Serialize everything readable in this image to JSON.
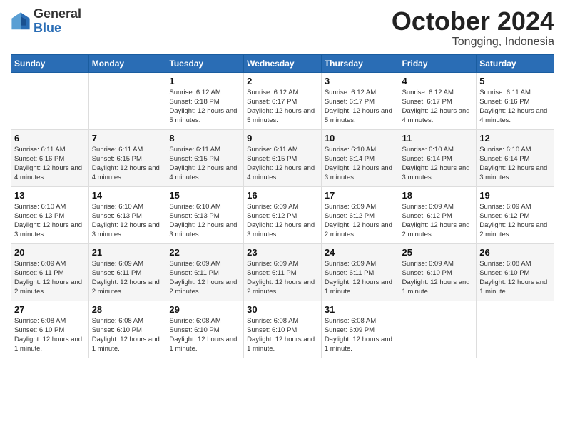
{
  "header": {
    "logo_general": "General",
    "logo_blue": "Blue",
    "month_year": "October 2024",
    "location": "Tongging, Indonesia"
  },
  "days_of_week": [
    "Sunday",
    "Monday",
    "Tuesday",
    "Wednesday",
    "Thursday",
    "Friday",
    "Saturday"
  ],
  "weeks": [
    [
      {
        "day": "",
        "info": ""
      },
      {
        "day": "",
        "info": ""
      },
      {
        "day": "1",
        "info": "Sunrise: 6:12 AM\nSunset: 6:18 PM\nDaylight: 12 hours and 5 minutes."
      },
      {
        "day": "2",
        "info": "Sunrise: 6:12 AM\nSunset: 6:17 PM\nDaylight: 12 hours and 5 minutes."
      },
      {
        "day": "3",
        "info": "Sunrise: 6:12 AM\nSunset: 6:17 PM\nDaylight: 12 hours and 5 minutes."
      },
      {
        "day": "4",
        "info": "Sunrise: 6:12 AM\nSunset: 6:17 PM\nDaylight: 12 hours and 4 minutes."
      },
      {
        "day": "5",
        "info": "Sunrise: 6:11 AM\nSunset: 6:16 PM\nDaylight: 12 hours and 4 minutes."
      }
    ],
    [
      {
        "day": "6",
        "info": "Sunrise: 6:11 AM\nSunset: 6:16 PM\nDaylight: 12 hours and 4 minutes."
      },
      {
        "day": "7",
        "info": "Sunrise: 6:11 AM\nSunset: 6:15 PM\nDaylight: 12 hours and 4 minutes."
      },
      {
        "day": "8",
        "info": "Sunrise: 6:11 AM\nSunset: 6:15 PM\nDaylight: 12 hours and 4 minutes."
      },
      {
        "day": "9",
        "info": "Sunrise: 6:11 AM\nSunset: 6:15 PM\nDaylight: 12 hours and 4 minutes."
      },
      {
        "day": "10",
        "info": "Sunrise: 6:10 AM\nSunset: 6:14 PM\nDaylight: 12 hours and 3 minutes."
      },
      {
        "day": "11",
        "info": "Sunrise: 6:10 AM\nSunset: 6:14 PM\nDaylight: 12 hours and 3 minutes."
      },
      {
        "day": "12",
        "info": "Sunrise: 6:10 AM\nSunset: 6:14 PM\nDaylight: 12 hours and 3 minutes."
      }
    ],
    [
      {
        "day": "13",
        "info": "Sunrise: 6:10 AM\nSunset: 6:13 PM\nDaylight: 12 hours and 3 minutes."
      },
      {
        "day": "14",
        "info": "Sunrise: 6:10 AM\nSunset: 6:13 PM\nDaylight: 12 hours and 3 minutes."
      },
      {
        "day": "15",
        "info": "Sunrise: 6:10 AM\nSunset: 6:13 PM\nDaylight: 12 hours and 3 minutes."
      },
      {
        "day": "16",
        "info": "Sunrise: 6:09 AM\nSunset: 6:12 PM\nDaylight: 12 hours and 3 minutes."
      },
      {
        "day": "17",
        "info": "Sunrise: 6:09 AM\nSunset: 6:12 PM\nDaylight: 12 hours and 2 minutes."
      },
      {
        "day": "18",
        "info": "Sunrise: 6:09 AM\nSunset: 6:12 PM\nDaylight: 12 hours and 2 minutes."
      },
      {
        "day": "19",
        "info": "Sunrise: 6:09 AM\nSunset: 6:12 PM\nDaylight: 12 hours and 2 minutes."
      }
    ],
    [
      {
        "day": "20",
        "info": "Sunrise: 6:09 AM\nSunset: 6:11 PM\nDaylight: 12 hours and 2 minutes."
      },
      {
        "day": "21",
        "info": "Sunrise: 6:09 AM\nSunset: 6:11 PM\nDaylight: 12 hours and 2 minutes."
      },
      {
        "day": "22",
        "info": "Sunrise: 6:09 AM\nSunset: 6:11 PM\nDaylight: 12 hours and 2 minutes."
      },
      {
        "day": "23",
        "info": "Sunrise: 6:09 AM\nSunset: 6:11 PM\nDaylight: 12 hours and 2 minutes."
      },
      {
        "day": "24",
        "info": "Sunrise: 6:09 AM\nSunset: 6:11 PM\nDaylight: 12 hours and 1 minute."
      },
      {
        "day": "25",
        "info": "Sunrise: 6:09 AM\nSunset: 6:10 PM\nDaylight: 12 hours and 1 minute."
      },
      {
        "day": "26",
        "info": "Sunrise: 6:08 AM\nSunset: 6:10 PM\nDaylight: 12 hours and 1 minute."
      }
    ],
    [
      {
        "day": "27",
        "info": "Sunrise: 6:08 AM\nSunset: 6:10 PM\nDaylight: 12 hours and 1 minute."
      },
      {
        "day": "28",
        "info": "Sunrise: 6:08 AM\nSunset: 6:10 PM\nDaylight: 12 hours and 1 minute."
      },
      {
        "day": "29",
        "info": "Sunrise: 6:08 AM\nSunset: 6:10 PM\nDaylight: 12 hours and 1 minute."
      },
      {
        "day": "30",
        "info": "Sunrise: 6:08 AM\nSunset: 6:10 PM\nDaylight: 12 hours and 1 minute."
      },
      {
        "day": "31",
        "info": "Sunrise: 6:08 AM\nSunset: 6:09 PM\nDaylight: 12 hours and 1 minute."
      },
      {
        "day": "",
        "info": ""
      },
      {
        "day": "",
        "info": ""
      }
    ]
  ]
}
